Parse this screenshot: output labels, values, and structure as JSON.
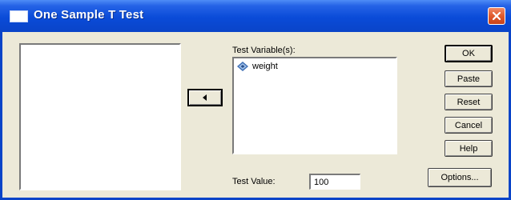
{
  "window": {
    "title": "One Sample T Test",
    "icon": "window-icon",
    "close_icon": "close-icon"
  },
  "source_list": {
    "items": []
  },
  "move_button": {
    "icon": "left-arrow-icon"
  },
  "test_variables": {
    "label": "Test Variable(s):",
    "items": [
      {
        "label": "weight",
        "icon": "scale-variable-icon"
      }
    ]
  },
  "test_value": {
    "label": "Test Value:",
    "value": "100"
  },
  "buttons": {
    "ok": "OK",
    "paste": "Paste",
    "reset": "Reset",
    "cancel": "Cancel",
    "help": "Help",
    "options": "Options..."
  },
  "colors": {
    "titlebar": "#0a44c8",
    "dialog_bg": "#ece9d8",
    "close_button": "#e05a2c"
  }
}
